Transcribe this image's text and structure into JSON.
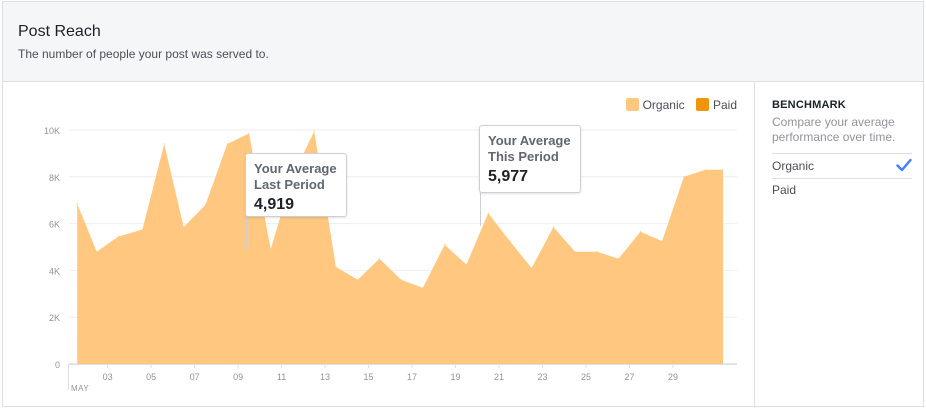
{
  "header": {
    "title": "Post Reach",
    "subtitle": "The number of people your post was served to."
  },
  "legend": [
    {
      "label": "Organic",
      "color": "#ffc780"
    },
    {
      "label": "Paid",
      "color": "#f2940b"
    }
  ],
  "benchmark": {
    "title": "BENCHMARK",
    "description": "Compare your average performance over time.",
    "options": [
      {
        "label": "Organic",
        "selected": true
      },
      {
        "label": "Paid",
        "selected": false
      }
    ],
    "check_icon": "check-icon",
    "check_color": "#4080ff"
  },
  "tooltips": {
    "last": {
      "line1": "Your Average",
      "line2": "Last Period",
      "value": "4,919"
    },
    "this": {
      "line1": "Your Average",
      "line2": "This Period",
      "value": "5,977"
    }
  },
  "chart_data": {
    "type": "area",
    "ytick_labels": [
      "0",
      "2K",
      "4K",
      "6K",
      "8K",
      "10K"
    ],
    "ytick_values": [
      0,
      2000,
      4000,
      6000,
      8000,
      10000
    ],
    "xtick_labels": [
      "03",
      "05",
      "07",
      "09",
      "11",
      "13",
      "15",
      "17",
      "19",
      "21",
      "23",
      "25",
      "27",
      "29"
    ],
    "xtick_days": [
      3,
      5,
      7,
      9,
      11,
      13,
      15,
      17,
      19,
      21,
      23,
      25,
      27,
      29
    ],
    "month_label": "MAY",
    "ylim": [
      0,
      10000
    ],
    "xlim": [
      1.5,
      31.3
    ],
    "grid": true,
    "series": [
      {
        "name": "Organic",
        "color": "#ffc780",
        "x": [
          1.6,
          2.5,
          3.5,
          4.6,
          5.6,
          6.5,
          7.5,
          8.5,
          9.5,
          10.5,
          11.5,
          12.5,
          13.5,
          14.5,
          15.5,
          16.5,
          17.5,
          18.5,
          19.5,
          20.5,
          21.5,
          22.5,
          23.5,
          24.5,
          25.5,
          26.5,
          27.5,
          28.5,
          29.5,
          30.5,
          31.3
        ],
        "values": [
          6850,
          4800,
          5450,
          5750,
          9400,
          5850,
          6800,
          9400,
          9850,
          4900,
          8000,
          9950,
          4150,
          3600,
          4500,
          3600,
          3250,
          5100,
          4250,
          6450,
          5250,
          4100,
          5850,
          4800,
          4800,
          4500,
          5650,
          5250,
          8000,
          8300,
          8300
        ]
      }
    ]
  }
}
